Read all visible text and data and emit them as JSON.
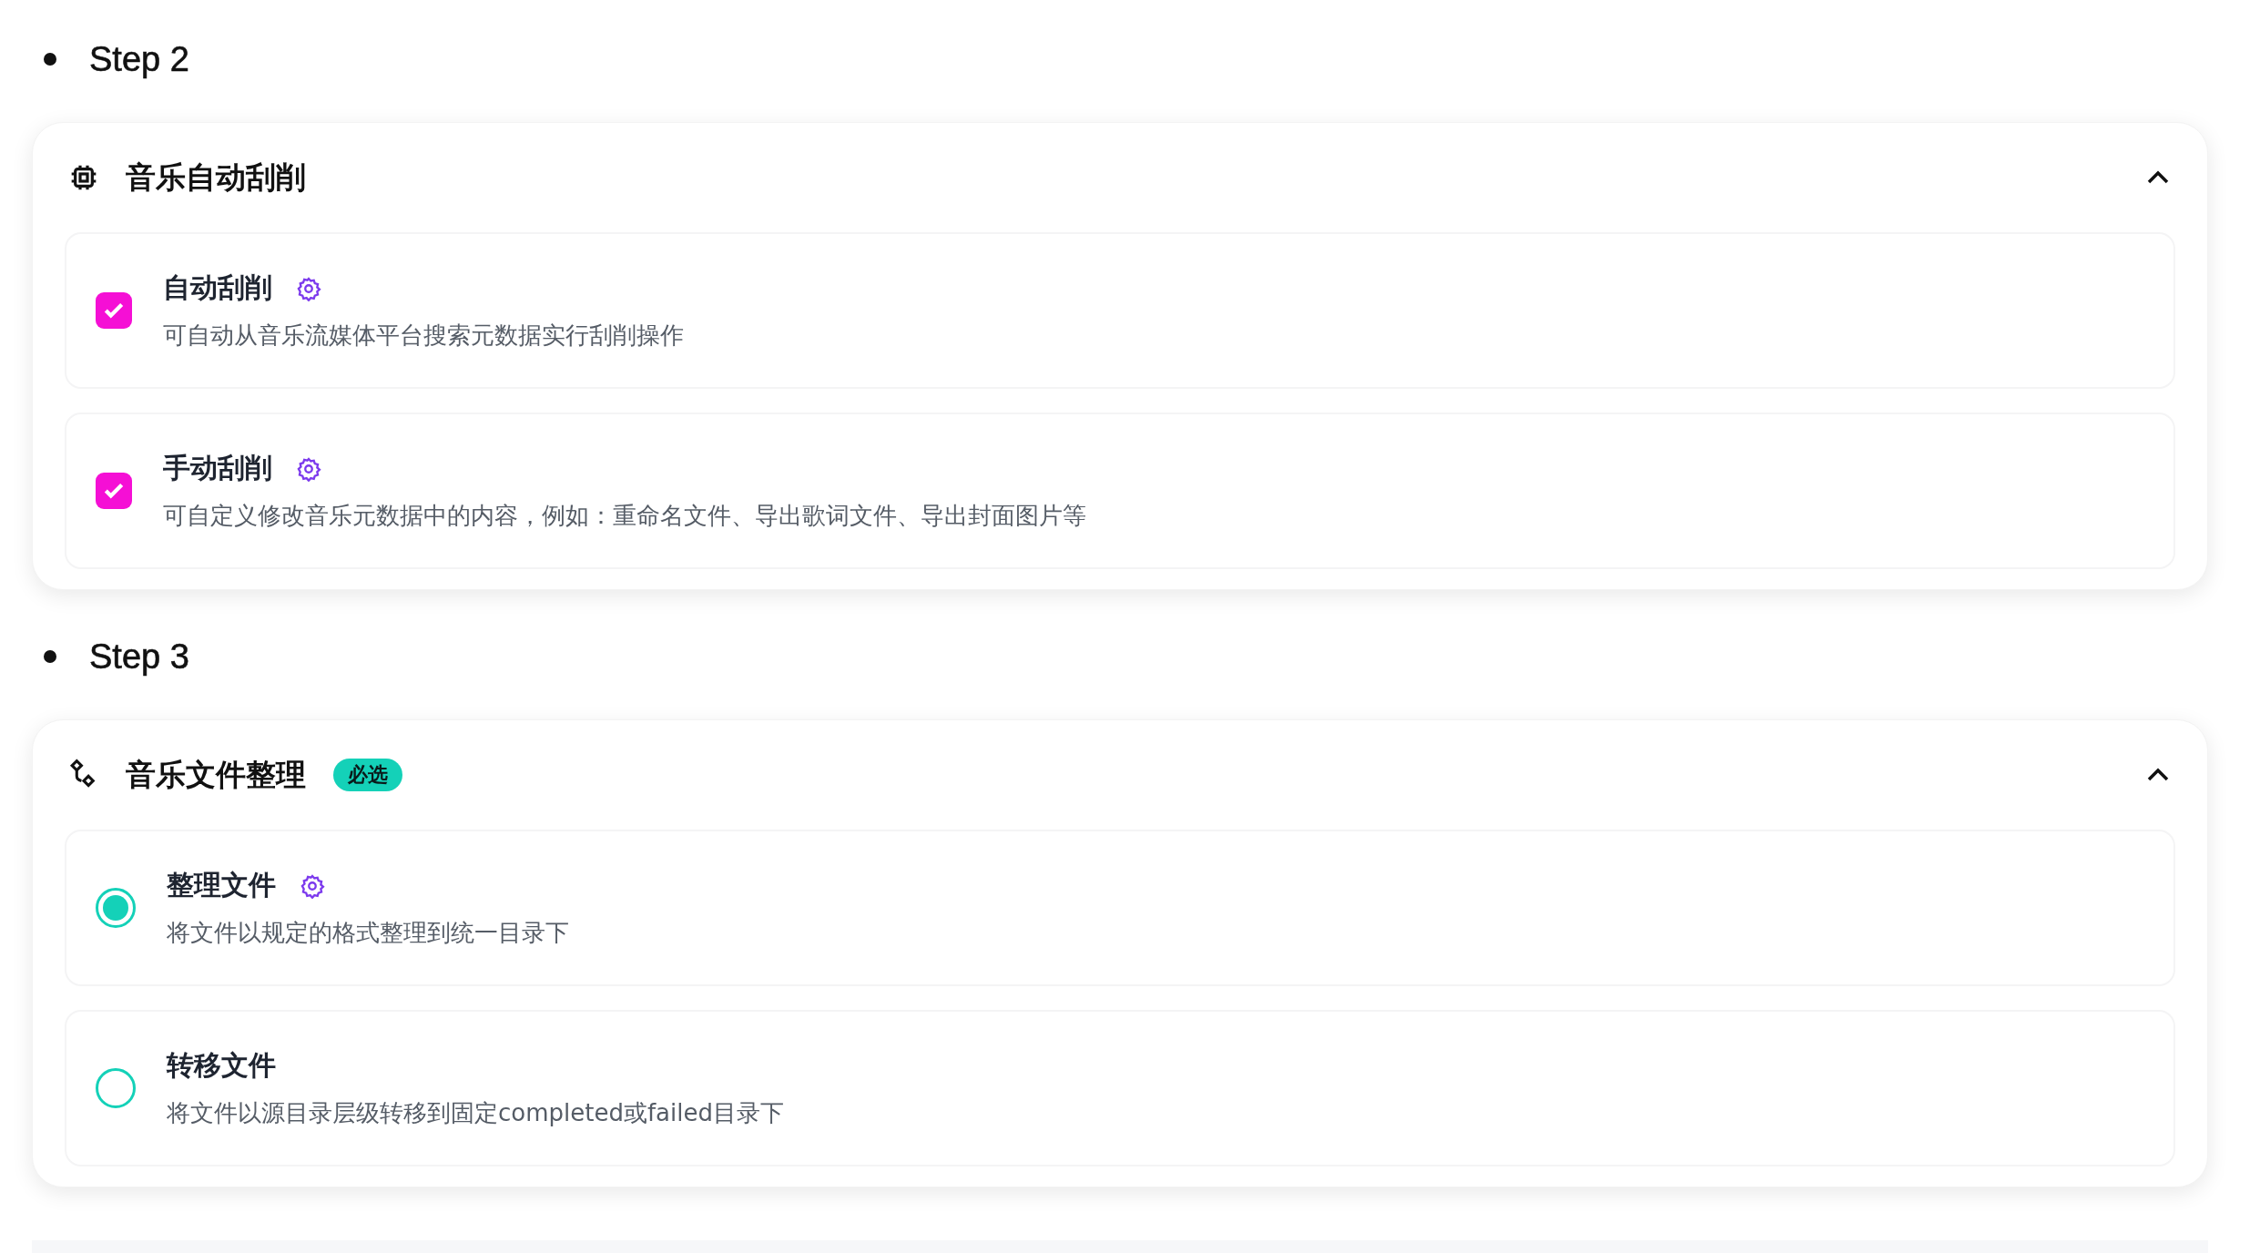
{
  "steps": [
    {
      "label": "Step 2",
      "card": {
        "title": "音乐自动刮削",
        "expanded": true,
        "options": [
          {
            "kind": "checkbox",
            "title": "自动刮削",
            "description": "可自动从音乐流媒体平台搜索元数据实行刮削操作",
            "checked": true,
            "settings": true
          },
          {
            "kind": "checkbox",
            "title": "手动刮削",
            "description": "可自定义修改音乐元数据中的内容，例如：重命名文件、导出歌词文件、导出封面图片等",
            "checked": true,
            "settings": true
          }
        ]
      }
    },
    {
      "label": "Step 3",
      "card": {
        "title": "音乐文件整理",
        "badge": "必选",
        "expanded": true,
        "options": [
          {
            "kind": "radio",
            "title": "整理文件",
            "description": "将文件以规定的格式整理到统一目录下",
            "selected": true,
            "settings": true
          },
          {
            "kind": "radio",
            "title": "转移文件",
            "description": "将文件以源目录层级转移到固定completed或failed目录下",
            "selected": false,
            "settings": false
          }
        ]
      }
    }
  ]
}
